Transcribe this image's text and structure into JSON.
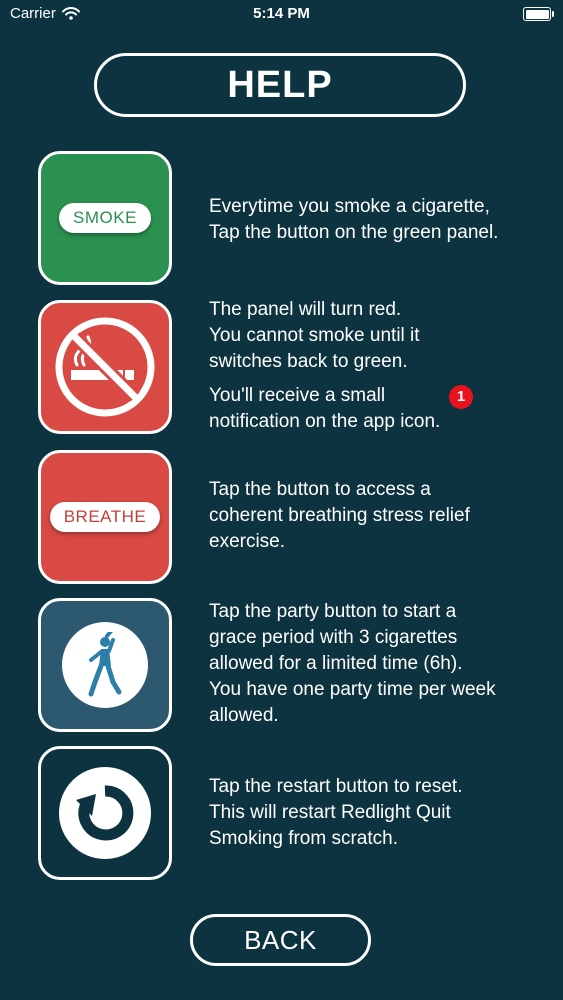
{
  "status_bar": {
    "carrier": "Carrier",
    "time": "5:14 PM",
    "battery_level": 1.0
  },
  "title": "HELP",
  "colors": {
    "background": "#0d3340",
    "green": "#2a9150",
    "red": "#d94a44",
    "navy": "#2c5970",
    "badge": "#e8131c"
  },
  "items": [
    {
      "icon": "smoke-button-tile",
      "button_label": "SMOKE",
      "lines": [
        "Everytime you smoke a cigarette,",
        "Tap the button on the green panel."
      ]
    },
    {
      "icon": "no-smoking-icon",
      "lines": [
        "The panel will turn red.",
        "You cannot smoke until it",
        "switches back to green."
      ],
      "extra_lines": [
        "You'll receive a small",
        "notification on the app icon."
      ],
      "badge": "1"
    },
    {
      "icon": "breathe-button-tile",
      "button_label": "BREATHE",
      "lines": [
        "Tap the button to access a",
        "coherent breathing stress relief",
        "exercise."
      ]
    },
    {
      "icon": "party-dancer-icon",
      "lines": [
        "Tap the party button to start a",
        "grace period with 3 cigarettes",
        "allowed for a limited time (6h).",
        "You have one party time per week",
        "allowed."
      ]
    },
    {
      "icon": "restart-icon",
      "lines": [
        "Tap the restart button to reset.",
        "This will restart Redlight Quit",
        "Smoking from scratch."
      ]
    }
  ],
  "back_label": "BACK"
}
